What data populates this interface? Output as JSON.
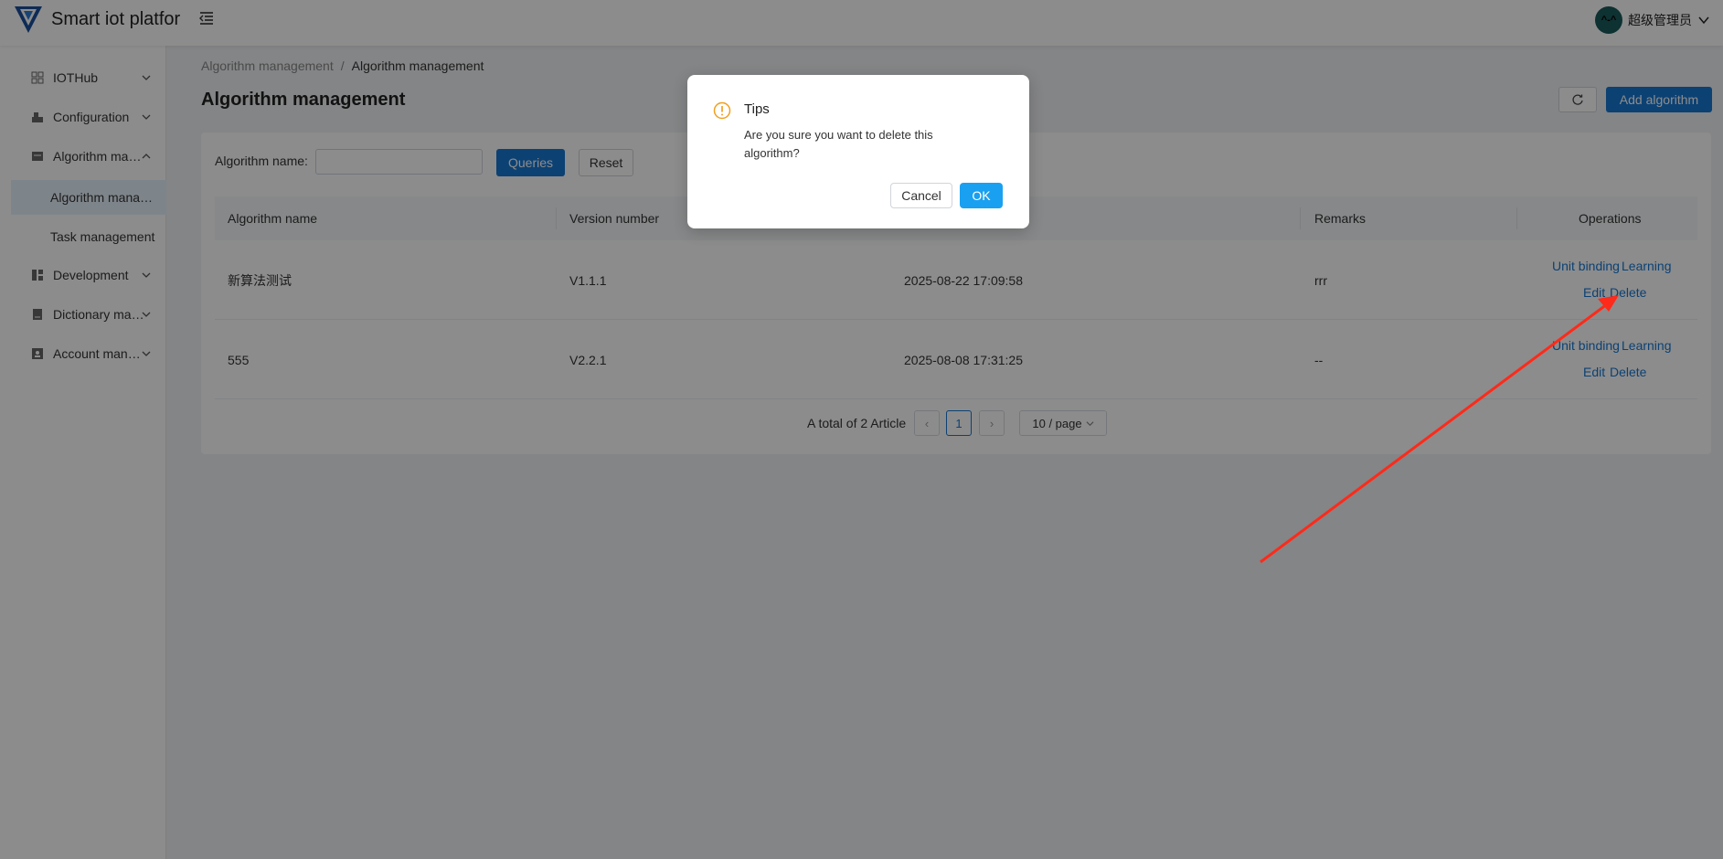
{
  "header": {
    "app_title": "Smart iot platform",
    "user_name": "超级管理员",
    "avatar_text": "^-^"
  },
  "sidebar": {
    "items": [
      {
        "label": "IOTHub",
        "icon": "grid-icon",
        "expanded": false
      },
      {
        "label": "Configuration",
        "icon": "config-icon",
        "expanded": false
      },
      {
        "label": "Algorithm management",
        "icon": "algorithm-icon",
        "expanded": true
      },
      {
        "label": "Development",
        "icon": "development-icon",
        "expanded": false
      },
      {
        "label": "Dictionary management",
        "icon": "dictionary-icon",
        "expanded": false
      },
      {
        "label": "Account management",
        "icon": "account-icon",
        "expanded": false
      }
    ],
    "sub_items": [
      {
        "label": "Algorithm management",
        "active": true
      },
      {
        "label": "Task management",
        "active": false
      }
    ]
  },
  "breadcrumb": {
    "parent": "Algorithm management",
    "separator": "/",
    "current": "Algorithm management"
  },
  "page": {
    "title": "Algorithm management",
    "add_label": "Add algorithm"
  },
  "filter": {
    "label": "Algorithm name:",
    "value": "",
    "queries_label": "Queries",
    "reset_label": "Reset"
  },
  "table": {
    "columns": [
      "Algorithm name",
      "Version number",
      "",
      "Remarks",
      "Operations"
    ],
    "rows": [
      {
        "name": "新算法测试",
        "version": "V1.1.1",
        "time": "2025-08-22 17:09:58",
        "remarks": "rrr"
      },
      {
        "name": "555",
        "version": "V2.2.1",
        "time": "2025-08-08 17:31:25",
        "remarks": "--"
      }
    ],
    "ops": {
      "unit_binding": "Unit binding",
      "learning": "Learning",
      "edit": "Edit",
      "delete": "Delete"
    }
  },
  "pagination": {
    "total_text": "A total of 2 Article",
    "current_page": "1",
    "prev": "‹",
    "next": "›",
    "page_size": "10 / page"
  },
  "dialog": {
    "title": "Tips",
    "message": "Are you sure you want to delete this algorithm?",
    "cancel_label": "Cancel",
    "ok_label": "OK"
  },
  "colors": {
    "primary": "#1677d2",
    "ok": "#1aa0f0",
    "warning": "#f0a020",
    "annotation_arrow": "#ff2a1a"
  }
}
